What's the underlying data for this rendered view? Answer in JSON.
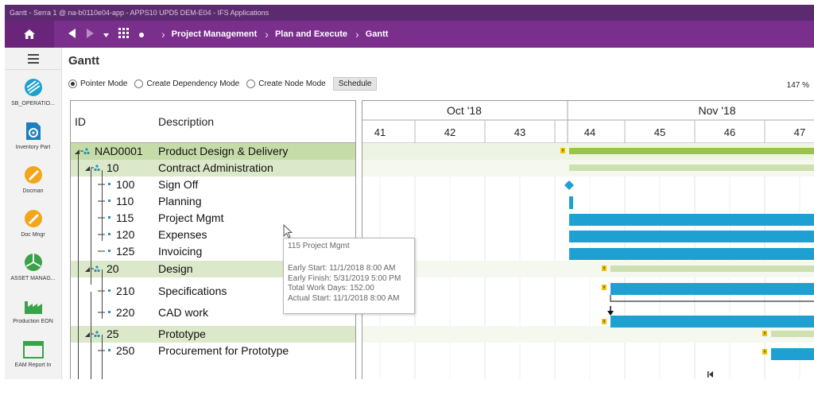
{
  "window": {
    "title": "Gantt - Serra 1 @ na-b0110e04-app - APPS10 UPD5 DEM-E04 - IFS Applications"
  },
  "breadcrumb": [
    "Project Management",
    "Plan and Execute",
    "Gantt"
  ],
  "sidebar": {
    "items": [
      {
        "label": "SB_OPERATIO...",
        "icon": "operations-icon",
        "color": "#1e9fd0"
      },
      {
        "label": "Inventory Part",
        "icon": "inventory-gear-icon",
        "color": "#1e7fc0"
      },
      {
        "label": "Docman",
        "icon": "docman-icon",
        "color": "#f2a619"
      },
      {
        "label": "Doc Mngr",
        "icon": "doc-manager-icon",
        "color": "#f2a619"
      },
      {
        "label": "ASSET MANAG...",
        "icon": "asset-pie-icon",
        "color": "#3aa34a"
      },
      {
        "label": "Production EON",
        "icon": "factory-icon",
        "color": "#3aa34a"
      },
      {
        "label": "EAM Report In",
        "icon": "report-window-icon",
        "color": "#3aa34a"
      }
    ]
  },
  "page": {
    "title": "Gantt",
    "zoom": "147 %"
  },
  "toolbar": {
    "modes": [
      {
        "label": "Pointer Mode",
        "selected": true
      },
      {
        "label": "Create Dependency Mode",
        "selected": false
      },
      {
        "label": "Create Node Mode",
        "selected": false
      }
    ],
    "schedule_label": "Schedule"
  },
  "grid": {
    "headers": {
      "id": "ID",
      "description": "Description"
    },
    "rows": [
      {
        "id": "NAD0001",
        "desc": "Product Design & Delivery",
        "level": 0,
        "kind": "summary"
      },
      {
        "id": "10",
        "desc": "Contract Administration",
        "level": 1,
        "kind": "summary"
      },
      {
        "id": "100",
        "desc": "Sign Off",
        "level": 2,
        "kind": "task"
      },
      {
        "id": "110",
        "desc": "Planning",
        "level": 2,
        "kind": "task"
      },
      {
        "id": "115",
        "desc": "Project Mgmt",
        "level": 2,
        "kind": "task"
      },
      {
        "id": "120",
        "desc": "Expenses",
        "level": 2,
        "kind": "task"
      },
      {
        "id": "125",
        "desc": "Invoicing",
        "level": 2,
        "kind": "task"
      },
      {
        "id": "20",
        "desc": "Design",
        "level": 1,
        "kind": "summary"
      },
      {
        "id": "210",
        "desc": "Specifications",
        "level": 2,
        "kind": "task"
      },
      {
        "id": "220",
        "desc": "CAD work",
        "level": 2,
        "kind": "task"
      },
      {
        "id": "25",
        "desc": "Prototype",
        "level": 1,
        "kind": "summary"
      },
      {
        "id": "250",
        "desc": "Procurement for Prototype",
        "level": 2,
        "kind": "task"
      }
    ]
  },
  "timeline": {
    "months": [
      "Oct '18",
      "Nov '18"
    ],
    "weeks": [
      "41",
      "42",
      "43",
      "44",
      "45",
      "46",
      "47"
    ]
  },
  "tooltip": {
    "title": "115 Project Mgmt",
    "lines": [
      "Early Start: 11/1/2018 8:00 AM",
      "Early Finish: 5/31/2019 5:00 PM",
      "Total Work Days: 152.00",
      "Actual Start: 11/1/2018 8:00 AM"
    ]
  },
  "colors": {
    "nav": "#7a2f8c",
    "summary_bar": "#9ac34a",
    "summary_bar_light": "#cfe0b0",
    "task_bar": "#1ea0d2",
    "milestone": "#1ea0d2",
    "warning": "#f2c200"
  }
}
